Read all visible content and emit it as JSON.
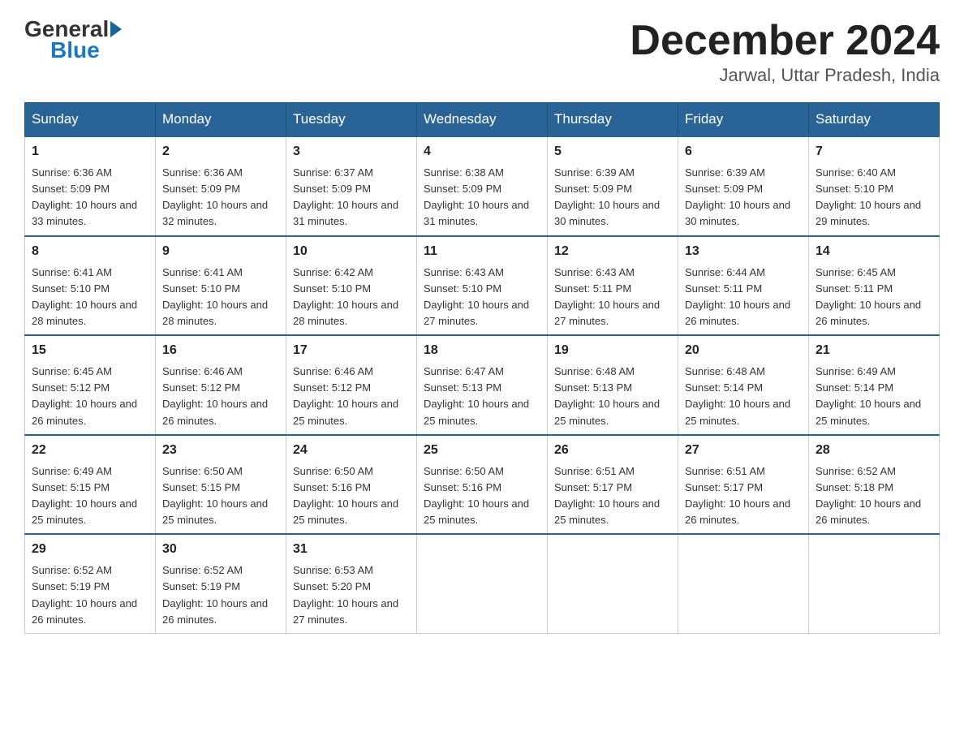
{
  "header": {
    "month_title": "December 2024",
    "location": "Jarwal, Uttar Pradesh, India",
    "logo_general": "General",
    "logo_blue": "Blue"
  },
  "days_of_week": [
    "Sunday",
    "Monday",
    "Tuesday",
    "Wednesday",
    "Thursday",
    "Friday",
    "Saturday"
  ],
  "weeks": [
    [
      {
        "day": "1",
        "sunrise": "6:36 AM",
        "sunset": "5:09 PM",
        "daylight": "10 hours and 33 minutes."
      },
      {
        "day": "2",
        "sunrise": "6:36 AM",
        "sunset": "5:09 PM",
        "daylight": "10 hours and 32 minutes."
      },
      {
        "day": "3",
        "sunrise": "6:37 AM",
        "sunset": "5:09 PM",
        "daylight": "10 hours and 31 minutes."
      },
      {
        "day": "4",
        "sunrise": "6:38 AM",
        "sunset": "5:09 PM",
        "daylight": "10 hours and 31 minutes."
      },
      {
        "day": "5",
        "sunrise": "6:39 AM",
        "sunset": "5:09 PM",
        "daylight": "10 hours and 30 minutes."
      },
      {
        "day": "6",
        "sunrise": "6:39 AM",
        "sunset": "5:09 PM",
        "daylight": "10 hours and 30 minutes."
      },
      {
        "day": "7",
        "sunrise": "6:40 AM",
        "sunset": "5:10 PM",
        "daylight": "10 hours and 29 minutes."
      }
    ],
    [
      {
        "day": "8",
        "sunrise": "6:41 AM",
        "sunset": "5:10 PM",
        "daylight": "10 hours and 28 minutes."
      },
      {
        "day": "9",
        "sunrise": "6:41 AM",
        "sunset": "5:10 PM",
        "daylight": "10 hours and 28 minutes."
      },
      {
        "day": "10",
        "sunrise": "6:42 AM",
        "sunset": "5:10 PM",
        "daylight": "10 hours and 28 minutes."
      },
      {
        "day": "11",
        "sunrise": "6:43 AM",
        "sunset": "5:10 PM",
        "daylight": "10 hours and 27 minutes."
      },
      {
        "day": "12",
        "sunrise": "6:43 AM",
        "sunset": "5:11 PM",
        "daylight": "10 hours and 27 minutes."
      },
      {
        "day": "13",
        "sunrise": "6:44 AM",
        "sunset": "5:11 PM",
        "daylight": "10 hours and 26 minutes."
      },
      {
        "day": "14",
        "sunrise": "6:45 AM",
        "sunset": "5:11 PM",
        "daylight": "10 hours and 26 minutes."
      }
    ],
    [
      {
        "day": "15",
        "sunrise": "6:45 AM",
        "sunset": "5:12 PM",
        "daylight": "10 hours and 26 minutes."
      },
      {
        "day": "16",
        "sunrise": "6:46 AM",
        "sunset": "5:12 PM",
        "daylight": "10 hours and 26 minutes."
      },
      {
        "day": "17",
        "sunrise": "6:46 AM",
        "sunset": "5:12 PM",
        "daylight": "10 hours and 25 minutes."
      },
      {
        "day": "18",
        "sunrise": "6:47 AM",
        "sunset": "5:13 PM",
        "daylight": "10 hours and 25 minutes."
      },
      {
        "day": "19",
        "sunrise": "6:48 AM",
        "sunset": "5:13 PM",
        "daylight": "10 hours and 25 minutes."
      },
      {
        "day": "20",
        "sunrise": "6:48 AM",
        "sunset": "5:14 PM",
        "daylight": "10 hours and 25 minutes."
      },
      {
        "day": "21",
        "sunrise": "6:49 AM",
        "sunset": "5:14 PM",
        "daylight": "10 hours and 25 minutes."
      }
    ],
    [
      {
        "day": "22",
        "sunrise": "6:49 AM",
        "sunset": "5:15 PM",
        "daylight": "10 hours and 25 minutes."
      },
      {
        "day": "23",
        "sunrise": "6:50 AM",
        "sunset": "5:15 PM",
        "daylight": "10 hours and 25 minutes."
      },
      {
        "day": "24",
        "sunrise": "6:50 AM",
        "sunset": "5:16 PM",
        "daylight": "10 hours and 25 minutes."
      },
      {
        "day": "25",
        "sunrise": "6:50 AM",
        "sunset": "5:16 PM",
        "daylight": "10 hours and 25 minutes."
      },
      {
        "day": "26",
        "sunrise": "6:51 AM",
        "sunset": "5:17 PM",
        "daylight": "10 hours and 25 minutes."
      },
      {
        "day": "27",
        "sunrise": "6:51 AM",
        "sunset": "5:17 PM",
        "daylight": "10 hours and 26 minutes."
      },
      {
        "day": "28",
        "sunrise": "6:52 AM",
        "sunset": "5:18 PM",
        "daylight": "10 hours and 26 minutes."
      }
    ],
    [
      {
        "day": "29",
        "sunrise": "6:52 AM",
        "sunset": "5:19 PM",
        "daylight": "10 hours and 26 minutes."
      },
      {
        "day": "30",
        "sunrise": "6:52 AM",
        "sunset": "5:19 PM",
        "daylight": "10 hours and 26 minutes."
      },
      {
        "day": "31",
        "sunrise": "6:53 AM",
        "sunset": "5:20 PM",
        "daylight": "10 hours and 27 minutes."
      },
      null,
      null,
      null,
      null
    ]
  ],
  "labels": {
    "sunrise_prefix": "Sunrise: ",
    "sunset_prefix": "Sunset: ",
    "daylight_prefix": "Daylight: "
  }
}
